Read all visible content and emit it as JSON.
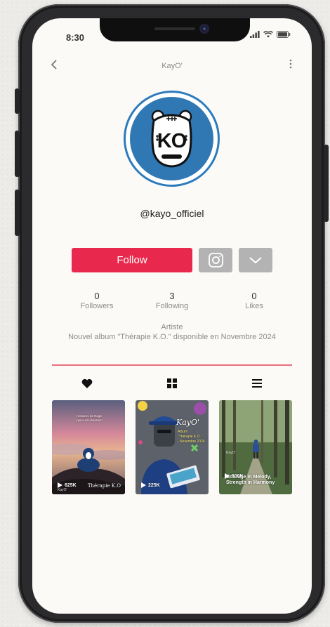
{
  "status_bar": {
    "time": "8:30"
  },
  "header": {
    "title": "KayO'"
  },
  "profile": {
    "avatar_text": "KO",
    "handle": "@kayo_officiel",
    "follow_label": "Follow"
  },
  "stats": [
    {
      "value": "0",
      "label": "Followers"
    },
    {
      "value": "3",
      "label": "Following"
    },
    {
      "value": "0",
      "label": "Likes"
    }
  ],
  "bio": {
    "role": "Artiste",
    "text": "Nouvel album \"Thérapie K.O.\" disponible en Novembre 2024"
  },
  "tabs": [
    {
      "icon": "heart-icon"
    },
    {
      "icon": "grid-icon"
    },
    {
      "icon": "list-icon"
    }
  ],
  "videos": [
    {
      "views": "625K",
      "caption_top": "Histoires de Rage\nLyrics et Liberation",
      "caption_bottom": "Thérapie K.O",
      "watermark": "KayO'"
    },
    {
      "views": "225K",
      "brand": "KayO'",
      "caption": "Album\n\"Thérapie K.O.\"\n- Novembre 2024"
    },
    {
      "views": "500K",
      "caption": "Courage in Melody,\nStrength in Harmony",
      "watermark": "KayO'"
    }
  ],
  "colors": {
    "accent": "#e8294d",
    "avatar_blue": "#2f78b4",
    "secondary_button": "#b3b3b3"
  }
}
